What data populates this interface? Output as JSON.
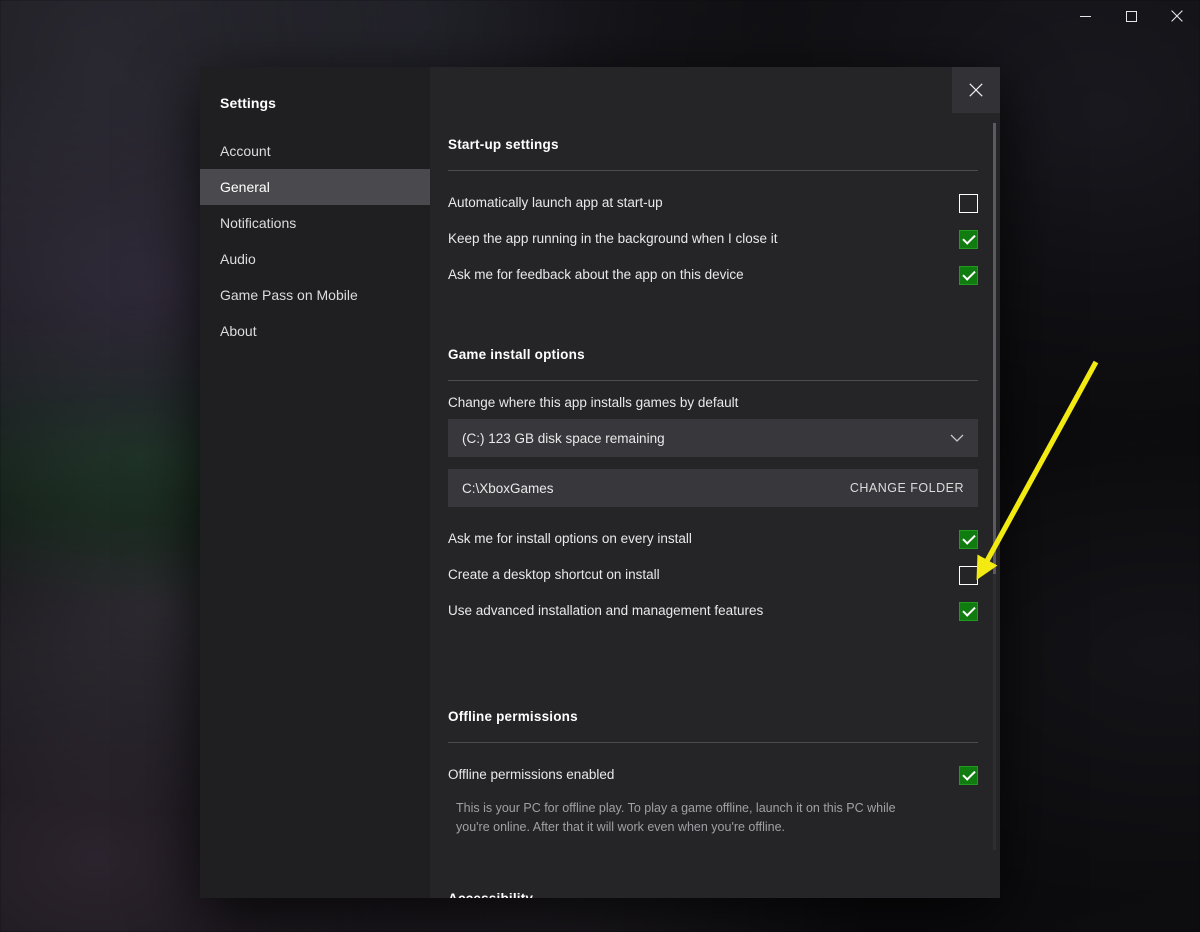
{
  "window": {
    "controls": [
      {
        "name": "minimize",
        "glyph": "minimize-icon"
      },
      {
        "name": "maximize",
        "glyph": "maximize-icon"
      },
      {
        "name": "close",
        "glyph": "close-icon"
      }
    ]
  },
  "dialog": {
    "close_label": "Close",
    "sidebar": {
      "title": "Settings",
      "items": [
        {
          "label": "Account",
          "active": false
        },
        {
          "label": "General",
          "active": true
        },
        {
          "label": "Notifications",
          "active": false
        },
        {
          "label": "Audio",
          "active": false
        },
        {
          "label": "Game Pass on Mobile",
          "active": false
        },
        {
          "label": "About",
          "active": false
        }
      ]
    },
    "sections": {
      "startup": {
        "heading": "Start-up settings",
        "rows": [
          {
            "label": "Automatically launch app at start-up",
            "checked": false
          },
          {
            "label": "Keep the app running in the background when I close it",
            "checked": true
          },
          {
            "label": "Ask me for feedback about the app on this device",
            "checked": true
          }
        ]
      },
      "install": {
        "heading": "Game install options",
        "field_label": "Change where this app installs games by default",
        "drive_value": "(C:) 123 GB disk space remaining",
        "path_value": "C:\\XboxGames",
        "change_folder_label": "CHANGE FOLDER",
        "rows": [
          {
            "label": "Ask me for install options on every install",
            "checked": true
          },
          {
            "label": "Create a desktop shortcut on install",
            "checked": false
          },
          {
            "label": "Use advanced installation and management features",
            "checked": true
          }
        ]
      },
      "offline": {
        "heading": "Offline permissions",
        "row_label": "Offline permissions enabled",
        "row_checked": true,
        "help_text": "This is your PC for offline play. To play a game offline, launch it on this PC while you're online. After that it will work even when you're offline."
      },
      "accessibility": {
        "heading": "Accessibility"
      }
    }
  },
  "annotation": {
    "arrow_color": "#f2ea10",
    "target": "Create a desktop shortcut on install checkbox"
  },
  "colors": {
    "accent_green": "#107c10",
    "dialog_bg": "#252528",
    "sidebar_bg": "#1f1f22",
    "nav_active_bg": "#4a4a4e",
    "field_bg": "#37373c"
  }
}
